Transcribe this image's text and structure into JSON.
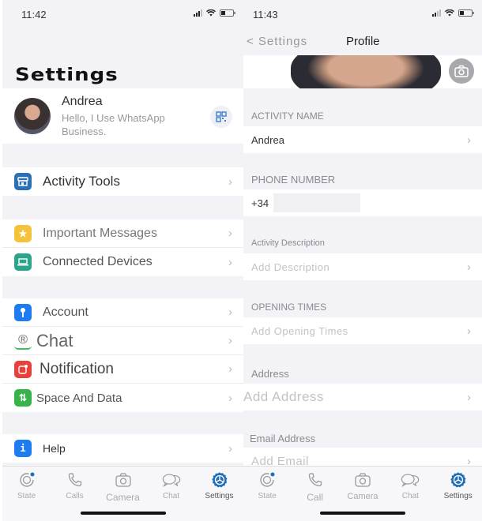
{
  "left": {
    "status_time": "11:42",
    "title": "Settings",
    "profile": {
      "name": "Andrea",
      "status": "Hello, I Use WhatsApp Business."
    },
    "groups": [
      {
        "items": [
          {
            "label": "Activity Tools",
            "icon": "store-icon",
            "color": "#2c6fb5"
          }
        ]
      },
      {
        "items": [
          {
            "label": "Important Messages",
            "icon": "star-icon",
            "color": "#f5c33b"
          },
          {
            "label": "Connected Devices",
            "icon": "laptop-icon",
            "color": "#2aa58c"
          }
        ]
      },
      {
        "items": [
          {
            "label": "Account",
            "icon": "key-icon",
            "color": "#1f7cf0"
          },
          {
            "label": "Chat",
            "icon": "chat-icon",
            "color": "#3cbf5c"
          },
          {
            "label": "Notification",
            "icon": "notification-icon",
            "color": "#e8403a"
          },
          {
            "label": "Space And Data",
            "icon": "data-icon",
            "color": "#37b34a"
          }
        ]
      },
      {
        "items": [
          {
            "label": "Help",
            "icon": "info-icon",
            "color": "#1f7cf0"
          }
        ]
      }
    ],
    "tabs": [
      {
        "label": "State",
        "icon": "status-icon"
      },
      {
        "label": "Calls",
        "icon": "phone-icon"
      },
      {
        "label": "Camera",
        "icon": "camera-icon"
      },
      {
        "label": "Chat",
        "icon": "chat-bubbles-icon"
      },
      {
        "label": "Settings",
        "icon": "settings-icon",
        "active": true
      }
    ]
  },
  "right": {
    "status_time": "11:43",
    "back_label": "< Settings",
    "title": "Profile",
    "sections": {
      "activity_name": {
        "header": "ACTIVITY NAME",
        "value": "Andrea"
      },
      "phone": {
        "header": "PHONE NUMBER",
        "value": "+34"
      },
      "description": {
        "header": "Activity Description",
        "placeholder": "Add Description"
      },
      "opening": {
        "header": "OPENING TIMES",
        "placeholder": "Add Opening Times"
      },
      "address": {
        "header": "Address",
        "placeholder": "Add Address"
      },
      "email": {
        "header": "Email Address",
        "placeholder": "Add Email"
      }
    },
    "tabs": [
      {
        "label": "State",
        "icon": "status-icon"
      },
      {
        "label": "Call",
        "icon": "phone-icon"
      },
      {
        "label": "Camera",
        "icon": "camera-icon"
      },
      {
        "label": "Chat",
        "icon": "chat-bubbles-icon"
      },
      {
        "label": "Settings",
        "icon": "settings-icon",
        "active": true
      }
    ]
  },
  "colors": {
    "accent": "#1f6fb8",
    "background": "#f2f2f7",
    "chevron": "#b8b8bf"
  }
}
